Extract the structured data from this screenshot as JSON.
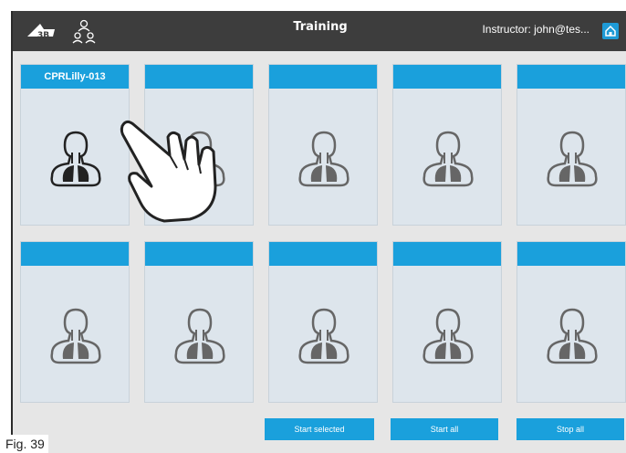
{
  "header": {
    "title": "Training",
    "instructor": "Instructor: john@tes...",
    "logo_icon": "3b-logo",
    "people_icon": "people-group-icon",
    "home_icon": "home-icon"
  },
  "stations": [
    {
      "label": "CPRLilly-013",
      "active": true
    },
    {
      "label": "",
      "active": false
    },
    {
      "label": "",
      "active": false
    },
    {
      "label": "",
      "active": false
    },
    {
      "label": "",
      "active": false
    },
    {
      "label": "",
      "active": false
    },
    {
      "label": "",
      "active": false
    },
    {
      "label": "",
      "active": false
    },
    {
      "label": "",
      "active": false
    },
    {
      "label": "",
      "active": false
    }
  ],
  "actions": {
    "start_selected": "Start selected",
    "start_all": "Start all",
    "stop_all": "Stop all"
  },
  "caption": "Fig. 39",
  "colors": {
    "accent": "#1aa0dc",
    "topbar": "#3d3d3d",
    "card": "#dde5ec"
  }
}
